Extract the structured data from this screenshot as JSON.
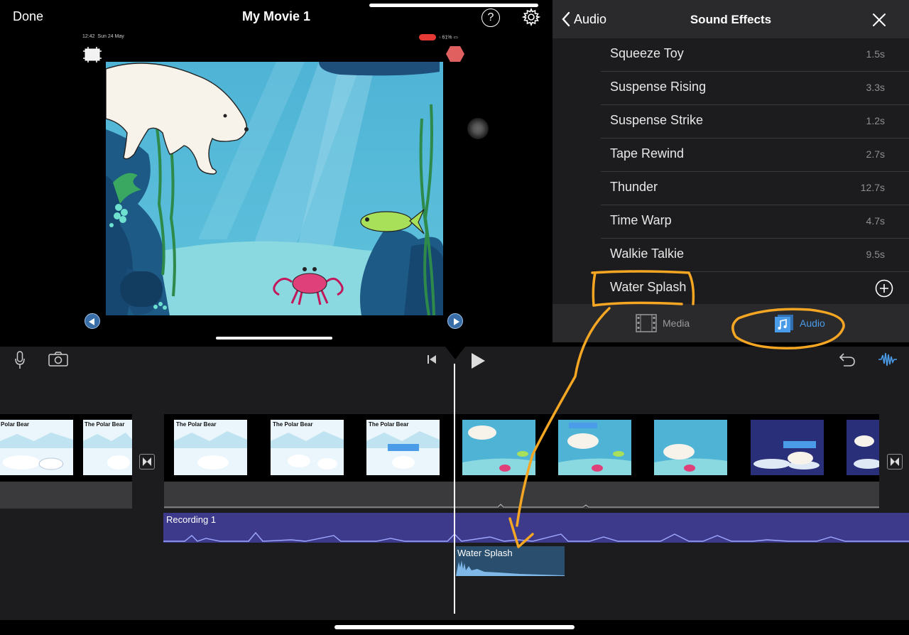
{
  "header": {
    "done_label": "Done",
    "title": "My Movie 1",
    "help_label": "?"
  },
  "preview": {
    "status_time": "12:42",
    "status_date": "Sun 24 May",
    "status_battery": "61%"
  },
  "panel": {
    "back_label": "Audio",
    "title": "Sound Effects",
    "items": [
      {
        "name": "Squeeze Toy",
        "duration": "1.5s"
      },
      {
        "name": "Suspense Rising",
        "duration": "3.3s"
      },
      {
        "name": "Suspense Strike",
        "duration": "1.2s"
      },
      {
        "name": "Tape Rewind",
        "duration": "2.7s"
      },
      {
        "name": "Thunder",
        "duration": "12.7s"
      },
      {
        "name": "Time Warp",
        "duration": "4.7s"
      },
      {
        "name": "Walkie Talkie",
        "duration": "9.5s"
      },
      {
        "name": "Water Splash",
        "duration": ""
      }
    ],
    "tabs": {
      "media": "Media",
      "audio": "Audio"
    }
  },
  "timeline": {
    "clips": [
      {
        "title": "Polar Bear"
      },
      {
        "title": "The Polar Bear"
      },
      {
        "title": "The Polar Bear"
      },
      {
        "title": "The Polar Bear"
      },
      {
        "title": "The Polar Bear"
      }
    ],
    "recording_label": "Recording 1",
    "splash_label": "Water Splash"
  },
  "colors": {
    "accent": "#4a9be8",
    "annotation": "#f5a623",
    "recording_track": "#3d3a8c",
    "splash_track": "#2a4f6e"
  }
}
